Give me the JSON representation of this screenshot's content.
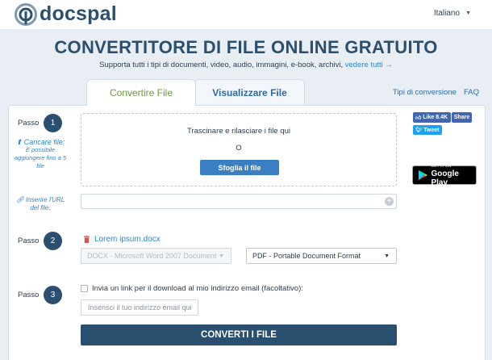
{
  "header": {
    "logo_text": "docspal",
    "language": "Italiano"
  },
  "hero": {
    "title": "CONVERTITORE DI FILE ONLINE GRATUITO",
    "subtitle": "Supporta tutti i tipi di documenti, video, audio, immagini, e-book, archivi,",
    "subtitle_link": "vedere tutti →"
  },
  "tabs": [
    {
      "label": "Convertire File",
      "active": true
    },
    {
      "label": "Visualizzare File",
      "active": false
    }
  ],
  "toplinks": {
    "conversion_types": "Tipi di conversione",
    "faq": "FAQ"
  },
  "steps": {
    "label": "Passo",
    "step1": "1",
    "step2": "2",
    "step3": "3"
  },
  "upload": {
    "side_title": "Caricare file:",
    "side_note": "È possibile aggiungere fino a 5 file",
    "drop_text": "Trascinare e rilasciare i file qui",
    "or_text": "O",
    "browse_label": "Sfoglia il file"
  },
  "url": {
    "side_label": "Inserire l'URL del file:",
    "value": ""
  },
  "file": {
    "name": "Lorem ipsum.docx"
  },
  "formats": {
    "from": "DOCX - Microsoft Word 2007 Document",
    "to": "PDF - Portable Document Format"
  },
  "email": {
    "checkbox_label": "Invia un link per il download al mio indirizzo email (facoltativo):",
    "placeholder": "Inserisci il tuo indirizzo email qui"
  },
  "convert_label": "CONVERTI I FILE",
  "social": {
    "like_label": "Like 8.4K",
    "share_label": "Share",
    "tweet_label": "Tweet"
  },
  "gplay": {
    "top": "GET IT ON",
    "bottom": "Google Play"
  },
  "colors": {
    "brand": "#2b4f6e",
    "link": "#2e86c9",
    "active_tab": "#6c9c36",
    "button": "#3a7fc1"
  }
}
